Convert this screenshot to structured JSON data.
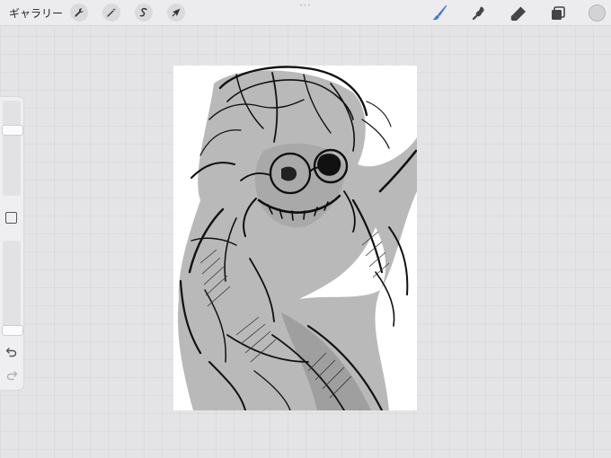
{
  "toolbar": {
    "gallery_label": "ギャラリー",
    "actions_icon": "wrench-icon",
    "adjustments_icon": "magic-wand-icon",
    "selection_icon": "selection-s-icon",
    "transform_icon": "arrow-cursor-icon"
  },
  "right_tools": {
    "brush_icon": "brush-icon",
    "smudge_icon": "smudge-icon",
    "eraser_icon": "eraser-icon",
    "layers_icon": "layers-icon",
    "active_tool": "brush",
    "brush_color": "#3a7bd5"
  },
  "current_color": "#d3d3d5",
  "sidebar": {
    "brush_size_level": 0.72,
    "opacity_level": 0.02,
    "modify_icon": "square-icon",
    "undo_icon": "undo-icon",
    "redo_icon": "redo-icon"
  },
  "canvas": {
    "content": "sketch-drawing",
    "background": "#ffffff"
  }
}
